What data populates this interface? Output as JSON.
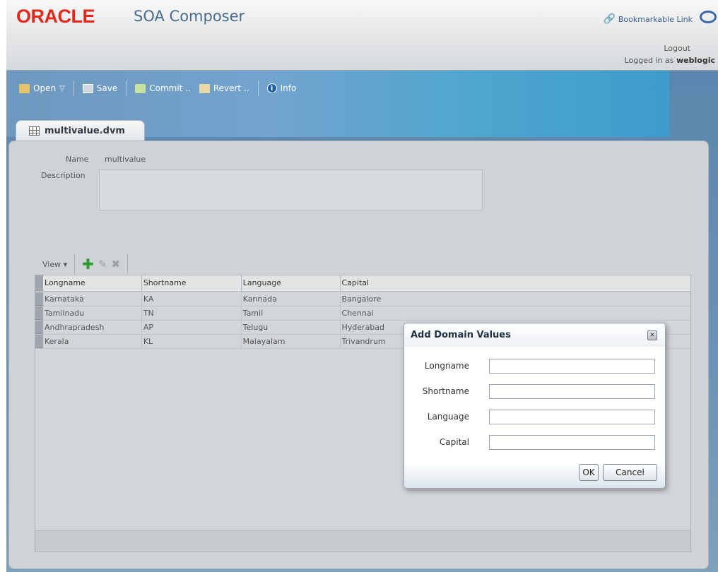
{
  "header": {
    "logo": "ORACLE",
    "app_title": "SOA Composer",
    "bookmark_label": "Bookmarkable Link",
    "logout_label": "Logout",
    "logged_in_prefix": "Logged in as",
    "username": "weblogic"
  },
  "toolbar": {
    "open_label": "Open",
    "save_label": "Save",
    "commit_label": "Commit ..",
    "revert_label": "Revert ..",
    "info_label": "Info"
  },
  "tab": {
    "label": "multivalue.dvm"
  },
  "editor": {
    "name_label": "Name",
    "name_value": "multivalue",
    "description_label": "Description",
    "description_value": ""
  },
  "grid": {
    "view_label": "View",
    "columns": [
      "Longname",
      "Shortname",
      "Language",
      "Capital"
    ],
    "rows": [
      [
        "Karnataka",
        "KA",
        "Kannada",
        "Bangalore"
      ],
      [
        "Tamilnadu",
        "TN",
        "Tamil",
        "Chennai"
      ],
      [
        "Andhrapradesh",
        "AP",
        "Telugu",
        "Hyderabad"
      ],
      [
        "Kerala",
        "KL",
        "Malayalam",
        "Trivandrum"
      ]
    ]
  },
  "dialog": {
    "title": "Add Domain Values",
    "fields": [
      {
        "label": "Longname",
        "value": ""
      },
      {
        "label": "Shortname",
        "value": ""
      },
      {
        "label": "Language",
        "value": ""
      },
      {
        "label": "Capital",
        "value": ""
      }
    ],
    "ok_label": "OK",
    "cancel_label": "Cancel"
  }
}
